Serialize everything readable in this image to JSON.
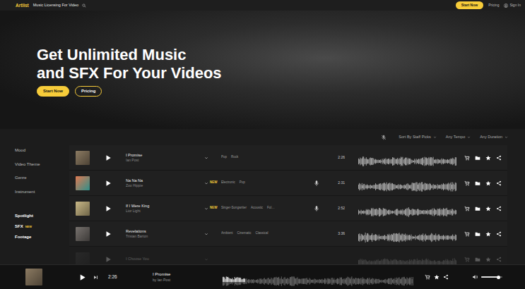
{
  "nav": {
    "logo": "Artlist",
    "tagline": "Music Licensing For Video",
    "start": "Start Now",
    "pricing": "Pricing",
    "signin": "Sign In"
  },
  "hero": {
    "title": [
      "Get Unlimited Music",
      "and SFX For Your Videos"
    ],
    "buttons": [
      {
        "label": "Start Now",
        "kind": "primary"
      },
      {
        "label": "Pricing",
        "kind": "outline"
      }
    ]
  },
  "filters": [
    "Sort By Staff Picks",
    "Any Tempo",
    "Any Duration"
  ],
  "sidebar": {
    "filters": [
      "Mood",
      "Video Theme",
      "Genre",
      "Instrument"
    ],
    "links": [
      {
        "label": "Spotlight"
      },
      {
        "label": "SFX",
        "badge": "NEW"
      },
      {
        "label": "Footage"
      }
    ]
  },
  "tracks": [
    {
      "title": "I Promise",
      "artist": "Ian Post",
      "tags": [
        "Pop",
        "Rock"
      ],
      "vocals": false,
      "duration": "2:26",
      "faded": false
    },
    {
      "title": "Na Na Na",
      "artist": "Zoo Hippie",
      "badge": "NEW",
      "tags": [
        "Electronic",
        "Pop"
      ],
      "vocals": true,
      "duration": "2:31",
      "faded": false
    },
    {
      "title": "If I Were King",
      "artist": "Lior Light",
      "badge": "NEW",
      "tags": [
        "Singer-Songwriter",
        "Acoustic",
        "Fol…"
      ],
      "vocals": true,
      "duration": "2:52",
      "faded": false
    },
    {
      "title": "Revelations",
      "artist": "Tristan Barton",
      "tags": [
        "Ambient",
        "Cinematic",
        "Classical"
      ],
      "vocals": false,
      "duration": "3:36",
      "faded": false
    },
    {
      "title": "I Choose You",
      "tags": [],
      "vocals": false,
      "faded": true
    }
  ],
  "player": {
    "title": "I Promise",
    "byline": "by Ian Post",
    "time": "2:26",
    "progress": 0.12,
    "volume": 0.8
  }
}
